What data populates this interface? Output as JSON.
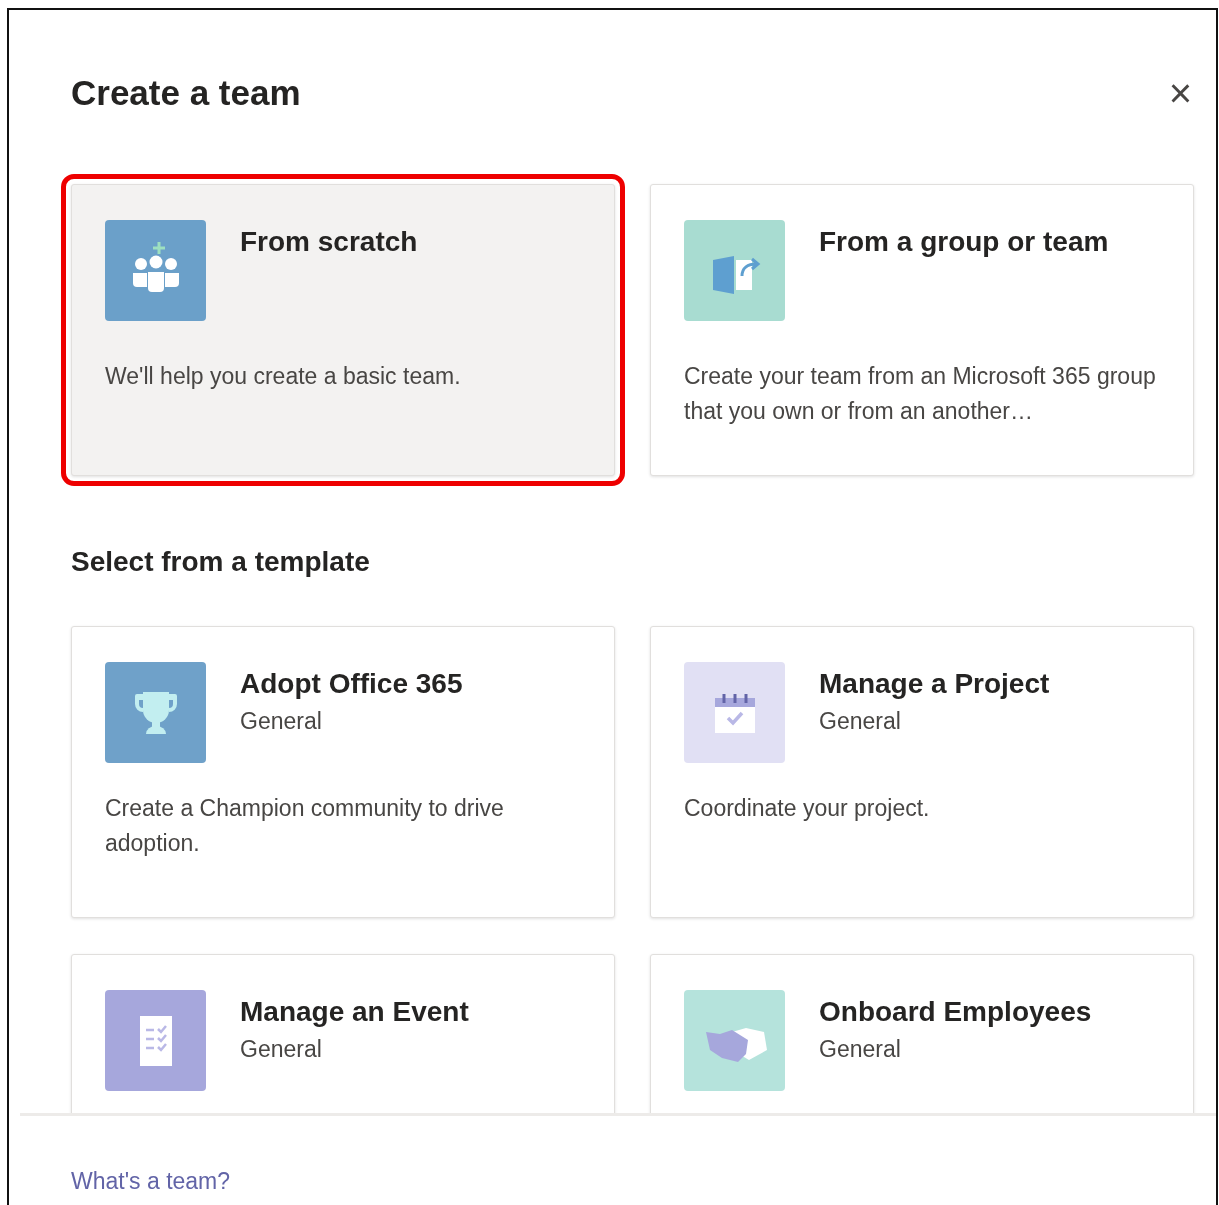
{
  "dialog": {
    "title": "Create a team",
    "close_label": "×"
  },
  "create_options": [
    {
      "title": "From scratch",
      "description": "We'll help you create a basic team.",
      "highlighted": true
    },
    {
      "title": "From a group or team",
      "description": "Create your team from an Microsoft 365 group that you own or from an another…",
      "highlighted": false
    }
  ],
  "template_section": {
    "heading": "Select from a template"
  },
  "templates": [
    {
      "title": "Adopt Office 365",
      "subtitle": "General",
      "description": "Create a Champion community to drive adoption."
    },
    {
      "title": "Manage a Project",
      "subtitle": "General",
      "description": "Coordinate your project."
    },
    {
      "title": "Manage an Event",
      "subtitle": "General"
    },
    {
      "title": "Onboard Employees",
      "subtitle": "General"
    }
  ],
  "footer": {
    "link": "What's a team?"
  }
}
